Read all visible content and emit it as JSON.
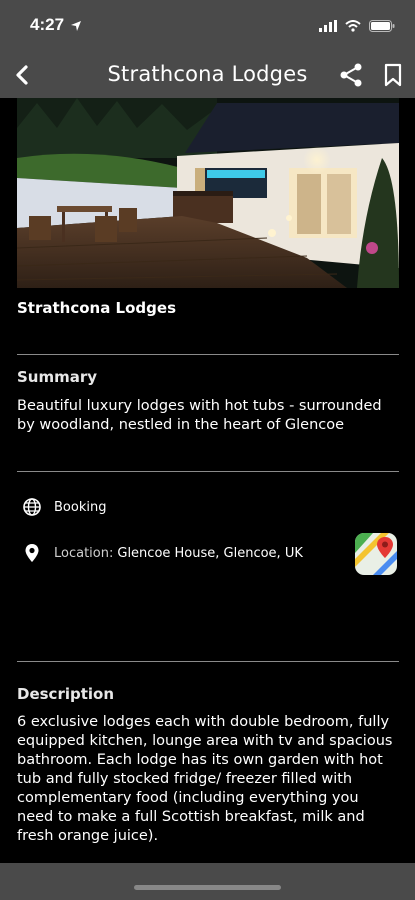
{
  "status": {
    "time": "4:27"
  },
  "nav": {
    "title": "Strathcona Lodges"
  },
  "listing": {
    "name": "Strathcona Lodges",
    "summary_title": "Summary",
    "summary_text": "Beautiful luxury lodges with hot tubs - surrounded by woodland, nestled in the heart of Glencoe",
    "booking_label": "Booking",
    "location_label": "Location:",
    "location_value": "Glencoe House, Glencoe, UK",
    "description_title": "Description",
    "description_text": "6 exclusive lodges each with double bedroom, fully equipped kitchen, lounge area with tv and spacious bathroom. Each lodge has its own garden with hot tub and fully stocked fridge/ freezer filled with complementary food (including everything you need to make a full Scottish breakfast, milk and fresh orange juice)."
  },
  "icons": {
    "back": "back-chevron-icon",
    "share": "share-icon",
    "bookmark": "bookmark-icon",
    "globe": "globe-icon",
    "location": "location-pin-icon",
    "maps": "maps-app-icon"
  },
  "colors": {
    "bar": "#4a4a4a",
    "background": "#000000",
    "text": "#ffffff",
    "divider": "#8a8a8a"
  }
}
